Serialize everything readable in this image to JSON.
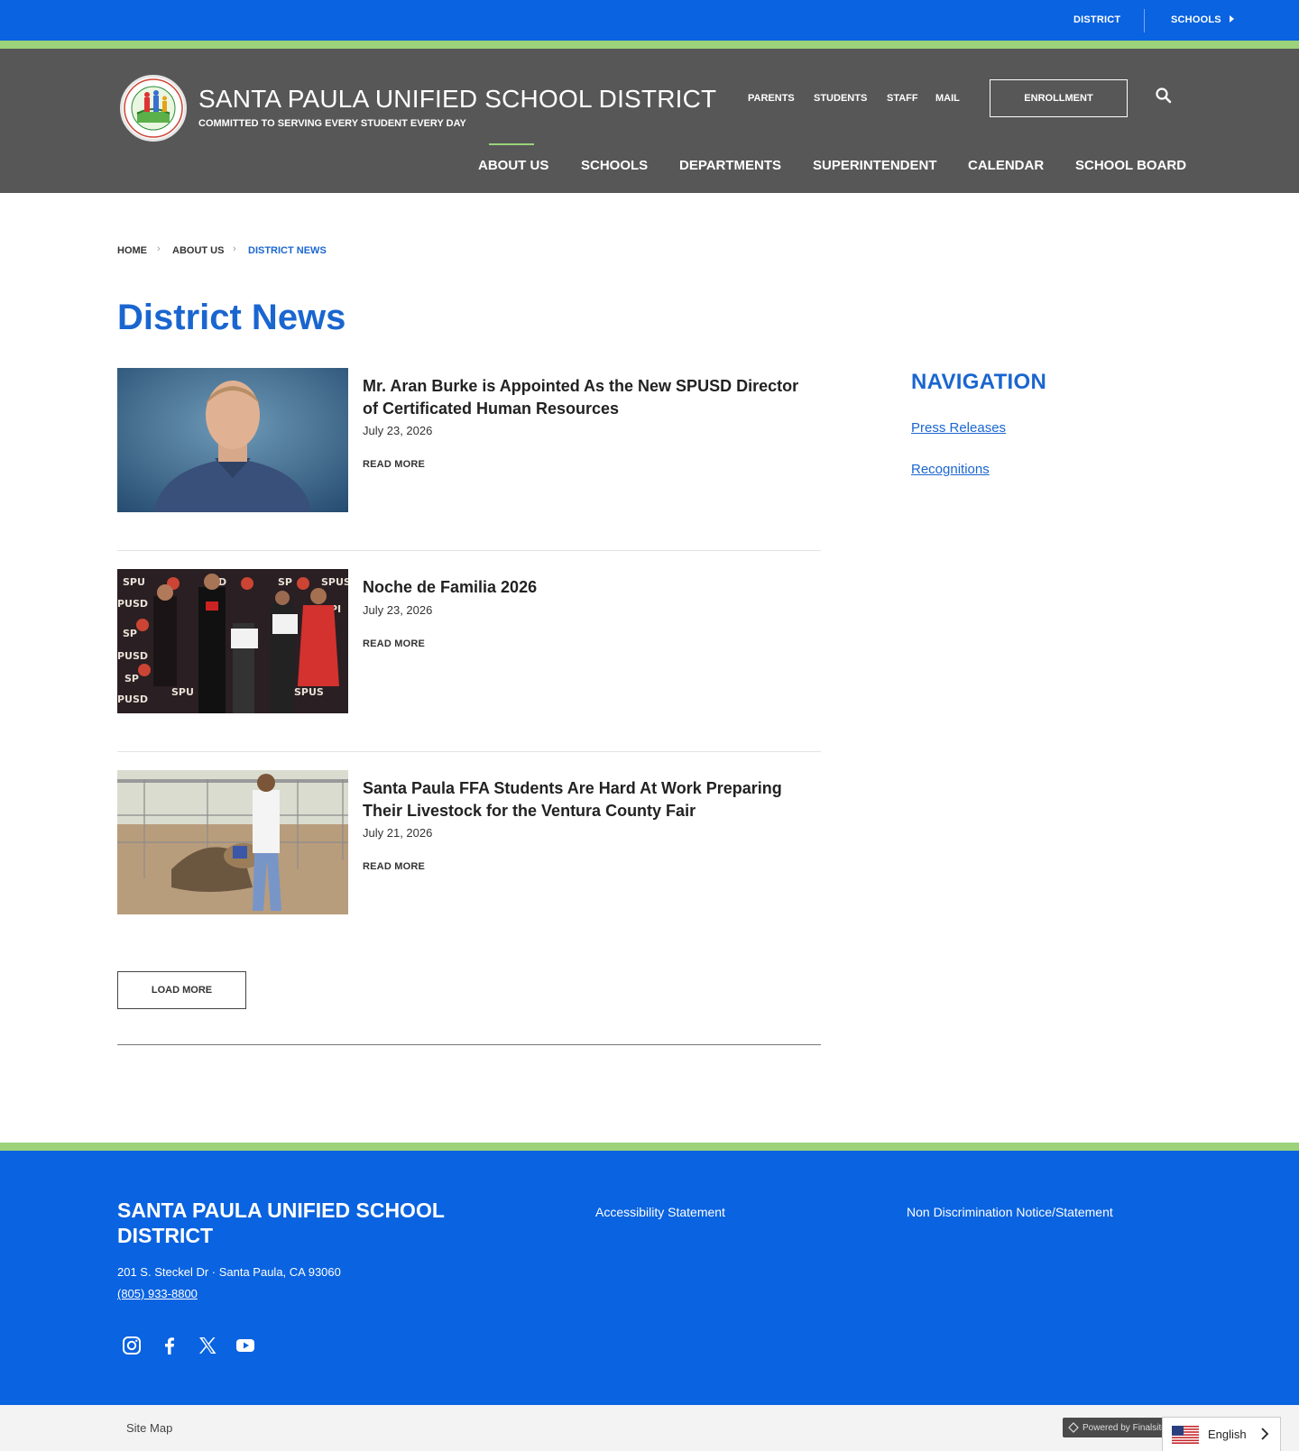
{
  "utility": {
    "district": "DISTRICT",
    "schools": "SCHOOLS"
  },
  "header": {
    "title": "SANTA PAULA UNIFIED SCHOOL DISTRICT",
    "tagline": "COMMITTED TO SERVING EVERY STUDENT EVERY DAY",
    "quick_links": [
      "PARENTS",
      "STUDENTS",
      "STAFF",
      "MAIL"
    ],
    "enrollment": "ENROLLMENT",
    "search_icon": "search-icon"
  },
  "main_nav": [
    "ABOUT US",
    "SCHOOLS",
    "DEPARTMENTS",
    "SUPERINTENDENT",
    "CALENDAR",
    "SCHOOL BOARD"
  ],
  "breadcrumb": [
    "HOME",
    "ABOUT US",
    "DISTRICT NEWS"
  ],
  "page_title": "District News",
  "news": [
    {
      "headline": "Mr. Aran Burke is Appointed As the New SPUSD Director of Certificated Human Resources",
      "date": "July 23, 2026",
      "read_more": "READ MORE"
    },
    {
      "headline": "Noche de Familia 2026",
      "date": "July 23, 2026",
      "read_more": "READ MORE"
    },
    {
      "headline": "Santa Paula FFA Students Are Hard At Work Preparing Their Livestock for the Ventura County Fair",
      "date": "July 21, 2026",
      "read_more": "READ MORE"
    }
  ],
  "load_more": "LOAD MORE",
  "sidebar": {
    "title": "NAVIGATION",
    "links": [
      "Press Releases",
      "Recognitions"
    ]
  },
  "footer": {
    "title": "SANTA PAULA UNIFIED SCHOOL DISTRICT",
    "address": "201 S. Steckel Dr  ·  Santa Paula, CA  93060",
    "phone": "(805) 933-8800",
    "links": [
      "Accessibility Statement",
      "Non Discrimination Notice/Statement"
    ],
    "social_icons": [
      "instagram-icon",
      "facebook-icon",
      "x-twitter-icon",
      "youtube-icon"
    ]
  },
  "bottom": {
    "site_map": "Site Map",
    "powered_by": "Powered by Finalsite",
    "language": "English"
  },
  "colors": {
    "brand_blue": "#0a63e0",
    "accent_green": "#9bd27a",
    "header_gray": "#575757",
    "title_blue": "#1a66d0"
  }
}
